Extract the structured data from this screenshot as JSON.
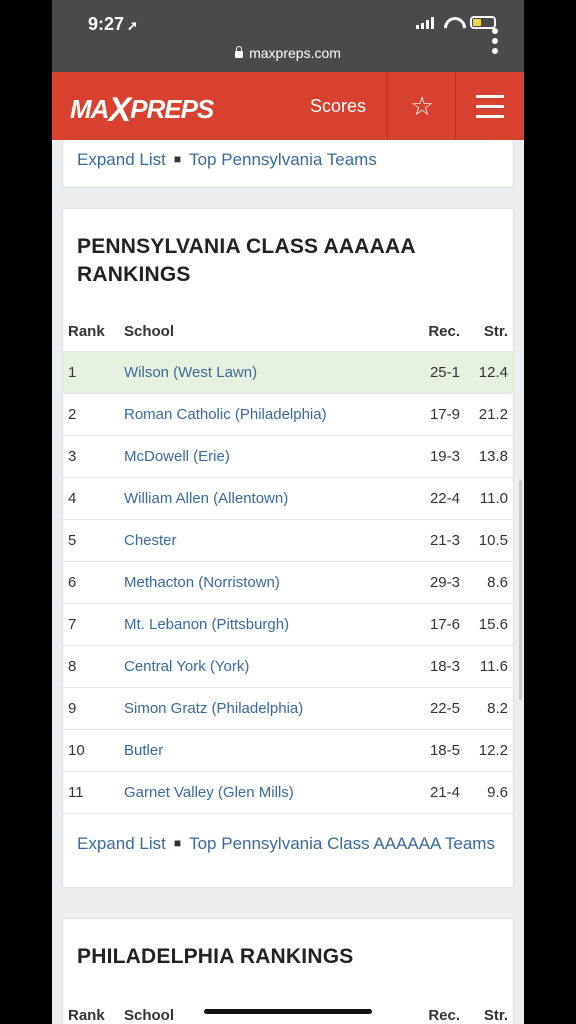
{
  "status_bar": {
    "time": "9:27",
    "url": "maxpreps.com"
  },
  "header": {
    "logo_left": "MA",
    "logo_x": "X",
    "logo_right": "PREPS",
    "scores_label": "Scores"
  },
  "top_card": {
    "expand_label": "Expand List",
    "top_teams_label": "Top Pennsylvania Teams"
  },
  "rankings": {
    "title": "PENNSYLVANIA CLASS AAAAAA RANKINGS",
    "columns": {
      "rank": "Rank",
      "school": "School",
      "rec": "Rec.",
      "str": "Str."
    },
    "rows": [
      {
        "rank": "1",
        "school": "Wilson (West Lawn)",
        "rec": "25-1",
        "str": "12.4"
      },
      {
        "rank": "2",
        "school": "Roman Catholic (Philadelphia)",
        "rec": "17-9",
        "str": "21.2"
      },
      {
        "rank": "3",
        "school": "McDowell (Erie)",
        "rec": "19-3",
        "str": "13.8"
      },
      {
        "rank": "4",
        "school": "William Allen (Allentown)",
        "rec": "22-4",
        "str": "11.0"
      },
      {
        "rank": "5",
        "school": "Chester",
        "rec": "21-3",
        "str": "10.5"
      },
      {
        "rank": "6",
        "school": "Methacton (Norristown)",
        "rec": "29-3",
        "str": "8.6"
      },
      {
        "rank": "7",
        "school": "Mt. Lebanon (Pittsburgh)",
        "rec": "17-6",
        "str": "15.6"
      },
      {
        "rank": "8",
        "school": "Central York (York)",
        "rec": "18-3",
        "str": "11.6"
      },
      {
        "rank": "9",
        "school": "Simon Gratz (Philadelphia)",
        "rec": "22-5",
        "str": "8.2"
      },
      {
        "rank": "10",
        "school": "Butler",
        "rec": "18-5",
        "str": "12.2"
      },
      {
        "rank": "11",
        "school": "Garnet Valley (Glen Mills)",
        "rec": "21-4",
        "str": "9.6"
      }
    ],
    "expand_label": "Expand List",
    "top_teams_label": "Top Pennsylvania Class AAAAAA Teams"
  },
  "philadelphia": {
    "title": "PHILADELPHIA RANKINGS",
    "columns": {
      "rank": "Rank",
      "school": "School",
      "rec": "Rec.",
      "str": "Str."
    }
  },
  "colors": {
    "brand_red": "#d8402f",
    "link_blue": "#3a6a9b",
    "highlight_green": "#e6f1df"
  }
}
